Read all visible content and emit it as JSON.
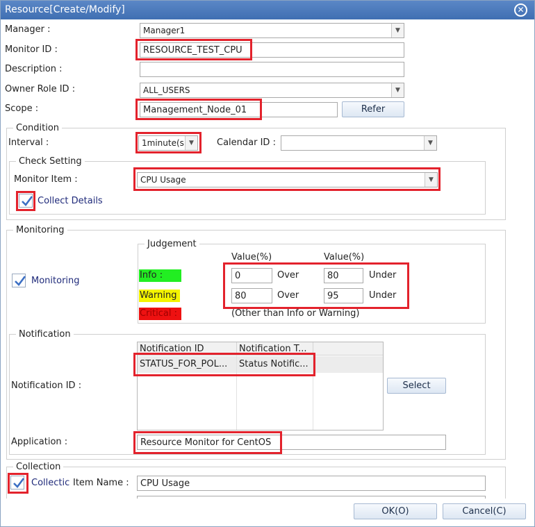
{
  "window": {
    "title": "Resource[Create/Modify]"
  },
  "icons": {
    "close": "close-circle-icon",
    "dropdown": "chevron-down-icon",
    "check": "checkmark-icon"
  },
  "colors": {
    "highlight": "#e3222c",
    "info": "#22ee22",
    "warning": "#f4f400",
    "critical": "#ee1111",
    "title_bar": "#4a7bbf"
  },
  "form": {
    "manager_label": "Manager :",
    "manager_value": "Manager1",
    "monitor_id_label": "Monitor ID :",
    "monitor_id_value": "RESOURCE_TEST_CPU",
    "description_label": "Description :",
    "description_value": "",
    "owner_role_label": "Owner Role ID :",
    "owner_role_value": "ALL_USERS",
    "scope_label": "Scope :",
    "scope_value": "Management_Node_01",
    "refer_button": "Refer"
  },
  "condition": {
    "legend": "Condition",
    "interval_label": "Interval :",
    "interval_value": "1minute(s",
    "calendar_label": "Calendar ID :",
    "calendar_value": "",
    "check_setting": {
      "legend": "Check Setting",
      "monitor_item_label": "Monitor Item :",
      "monitor_item_value": "CPU Usage",
      "collect_details_label": "Collect Details",
      "collect_details_checked": true
    }
  },
  "monitoring": {
    "legend": "Monitoring",
    "monitoring_label": "Monitoring",
    "monitoring_checked": true,
    "judgement": {
      "legend": "Judgement",
      "col1_header": "Value(%)",
      "col2_header": "Value(%)",
      "info_label": "Info :",
      "warning_label": "Warning",
      "critical_label": "Critical :",
      "info_lower": "0",
      "info_over": "Over",
      "info_upper": "80",
      "info_under": "Under",
      "warning_lower": "80",
      "warning_over": "Over",
      "warning_upper": "95",
      "warning_under": "Under",
      "critical_note": "(Other than Info or Warning)"
    },
    "notification": {
      "legend": "Notification",
      "notification_id_label": "Notification ID :",
      "columns": [
        "Notification ID",
        "Notification T..."
      ],
      "rows": [
        [
          "STATUS_FOR_POL...",
          "Status Notific..."
        ]
      ],
      "select_button": "Select",
      "application_label": "Application :",
      "application_value": "Resource Monitor for CentOS"
    }
  },
  "collection": {
    "legend": "Collection",
    "collection_label": "Collectic",
    "collection_checked": true,
    "item_name_label": "Item Name :",
    "item_name_value": "CPU Usage"
  },
  "footer": {
    "ok_button": "OK(O)",
    "cancel_button": "Cancel(C)"
  }
}
